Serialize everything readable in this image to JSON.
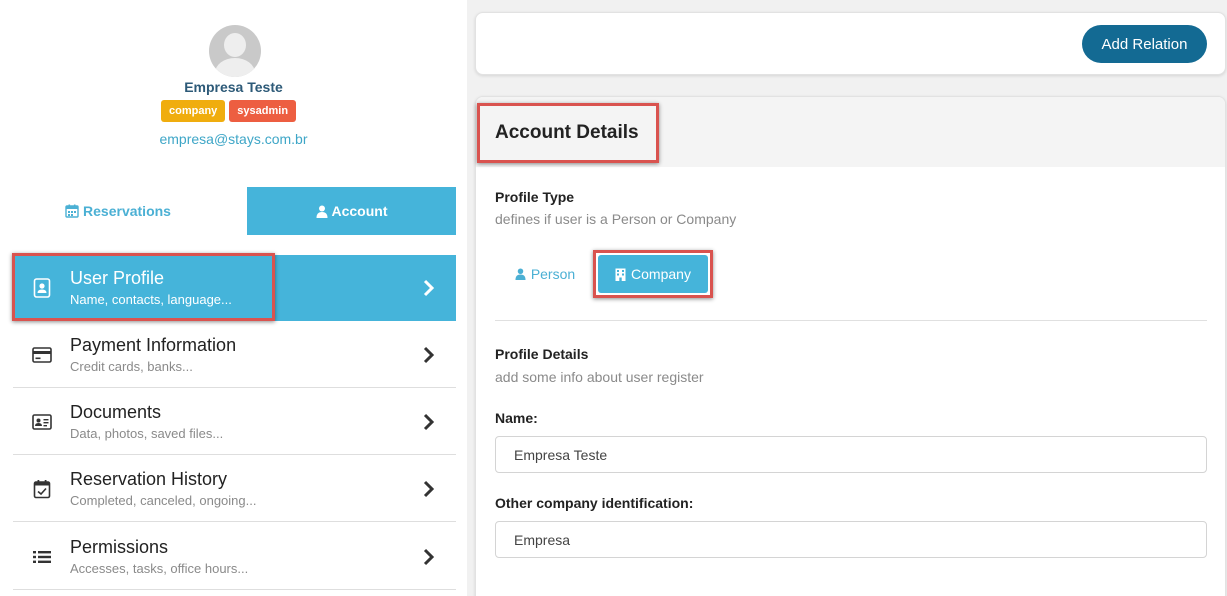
{
  "user": {
    "name": "Empresa Teste",
    "badges": [
      "company",
      "sysadmin"
    ],
    "email": "empresa@stays.com.br"
  },
  "tabs": {
    "reservations": {
      "label": "Reservations",
      "icon": "calendar-icon"
    },
    "account": {
      "label": "Account",
      "icon": "user-icon"
    }
  },
  "menu": [
    {
      "title": "User Profile",
      "subtitle": "Name, contacts, language...",
      "icon": "contact-card-icon",
      "active": true
    },
    {
      "title": "Payment Information",
      "subtitle": "Credit cards, banks...",
      "icon": "credit-card-icon"
    },
    {
      "title": "Documents",
      "subtitle": "Data, photos, saved files...",
      "icon": "id-card-icon"
    },
    {
      "title": "Reservation History",
      "subtitle": "Completed, canceled, ongoing...",
      "icon": "calendar-check-icon"
    },
    {
      "title": "Permissions",
      "subtitle": "Accesses, tasks, office hours...",
      "icon": "list-icon"
    }
  ],
  "actions": {
    "add_relation": "Add Relation"
  },
  "details": {
    "title": "Account Details",
    "profile_type": {
      "title": "Profile Type",
      "subtitle": "defines if user is a Person or Company",
      "person": "Person",
      "company": "Company",
      "selected": "Company"
    },
    "profile_details": {
      "title": "Profile Details",
      "subtitle": "add some info about user register"
    },
    "fields": {
      "name_label": "Name:",
      "name_value": "Empresa Teste",
      "other_id_label": "Other company identification:",
      "other_id_value": "Empresa"
    }
  },
  "colors": {
    "accent": "#45b4da",
    "primary_button": "#136a93",
    "badge_company": "#f0ad0e",
    "badge_sysadmin": "#ed5e41",
    "highlight": "#d9534f"
  }
}
